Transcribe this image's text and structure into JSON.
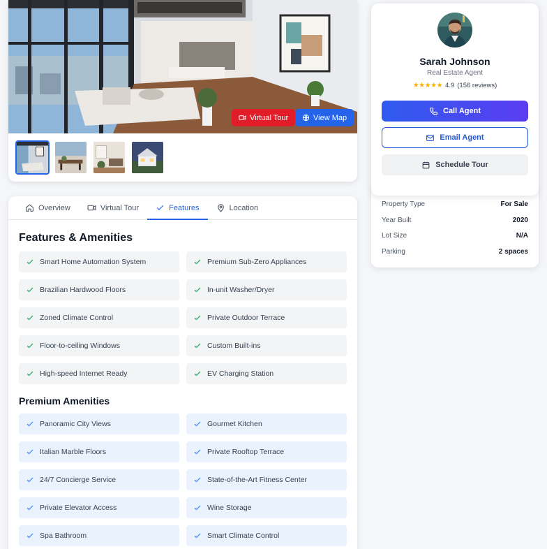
{
  "gallery": {
    "virtual_tour_label": "Virtual Tour",
    "view_map_label": "View Map",
    "thumbnails": [
      "living-room",
      "dining-area",
      "kitchen",
      "house-exterior"
    ]
  },
  "tabs": [
    {
      "label": "Overview",
      "icon": "home-icon"
    },
    {
      "label": "Virtual Tour",
      "icon": "video-icon"
    },
    {
      "label": "Features",
      "icon": "check-icon",
      "active": true
    },
    {
      "label": "Location",
      "icon": "map-pin-icon"
    }
  ],
  "features": {
    "title": "Features & Amenities",
    "items": [
      "Smart Home Automation System",
      "Premium Sub-Zero Appliances",
      "Brazilian Hardwood Floors",
      "In-unit Washer/Dryer",
      "Zoned Climate Control",
      "Private Outdoor Terrace",
      "Floor-to-ceiling Windows",
      "Custom Built-ins",
      "High-speed Internet Ready",
      "EV Charging Station"
    ]
  },
  "premium": {
    "title": "Premium Amenities",
    "items": [
      "Panoramic City Views",
      "Gourmet Kitchen",
      "Italian Marble Floors",
      "Private Rooftop Terrace",
      "24/7 Concierge Service",
      "State-of-the-Art Fitness Center",
      "Private Elevator Access",
      "Wine Storage",
      "Spa Bathroom",
      "Smart Climate Control"
    ]
  },
  "agent": {
    "name": "Sarah Johnson",
    "role": "Real Estate Agent",
    "stars": "★★★★★",
    "rating": "4.9",
    "reviews": "(156 reviews)",
    "call_label": "Call Agent",
    "email_label": "Email Agent",
    "schedule_label": "Schedule Tour"
  },
  "details": [
    {
      "key": "Property Type",
      "value": "For Sale"
    },
    {
      "key": "Year Built",
      "value": "2020"
    },
    {
      "key": "Lot Size",
      "value": "N/A"
    },
    {
      "key": "Parking",
      "value": "2 spaces"
    }
  ],
  "colors": {
    "accent": "#2563eb",
    "virtual_tour": "#e11d2a",
    "check_green": "#22a35a",
    "check_blue": "#3b82f6",
    "star": "#f5b400"
  }
}
